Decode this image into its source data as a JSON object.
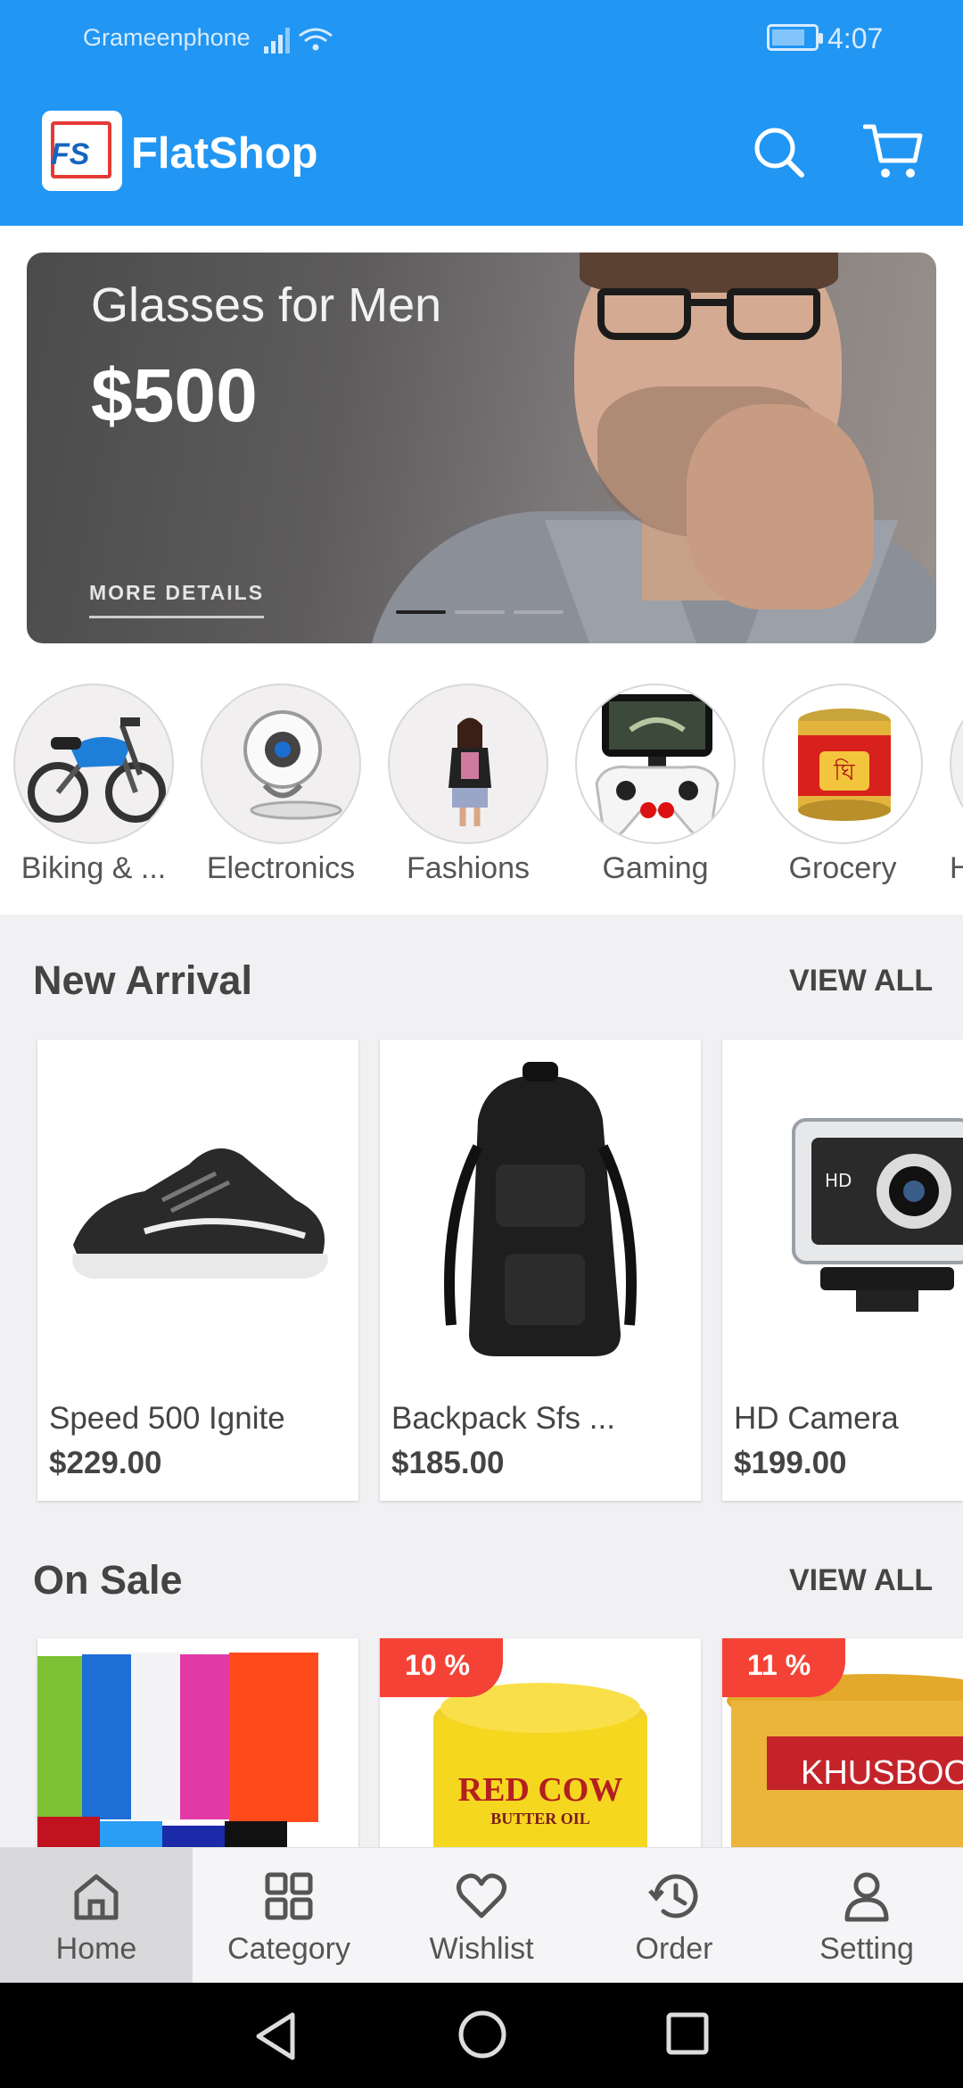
{
  "status_bar": {
    "carrier": "Grameenphone",
    "time": "4:07"
  },
  "header": {
    "logo_text": "FS",
    "title": "FlatShop"
  },
  "banner": {
    "title": "Glasses for Men",
    "price": "$500",
    "link": "MORE DETAILS",
    "slide_count": 3,
    "active_slide": 1
  },
  "categories": [
    {
      "label": "Biking & ..."
    },
    {
      "label": "Electronics"
    },
    {
      "label": "Fashions"
    },
    {
      "label": "Gaming"
    },
    {
      "label": "Grocery"
    },
    {
      "label": "H"
    }
  ],
  "new_arrival": {
    "title": "New Arrival",
    "view_all": "VIEW ALL",
    "products": [
      {
        "name": "Speed 500 Ignite",
        "price": "$229.00"
      },
      {
        "name": "Backpack Sfs ...",
        "price": "$185.00"
      },
      {
        "name": "HD Camera",
        "price": "$199.00"
      }
    ]
  },
  "on_sale": {
    "title": "On Sale",
    "view_all": "VIEW ALL",
    "products": [
      {
        "badge": ""
      },
      {
        "badge": "10 %",
        "image_text": "RED COW",
        "image_subtext": "BUTTER OIL"
      },
      {
        "badge": "11 %",
        "image_text": "KHUSBOO"
      }
    ]
  },
  "bottom_nav": [
    {
      "label": "Home",
      "icon": "home-icon",
      "active": true
    },
    {
      "label": "Category",
      "icon": "grid-icon",
      "active": false
    },
    {
      "label": "Wishlist",
      "icon": "heart-icon",
      "active": false
    },
    {
      "label": "Order",
      "icon": "history-icon",
      "active": false
    },
    {
      "label": "Setting",
      "icon": "person-icon",
      "active": false
    }
  ],
  "colors": {
    "primary": "#2196f3",
    "sale_badge": "#f44336",
    "nav_active_bg": "#d9d9db"
  }
}
